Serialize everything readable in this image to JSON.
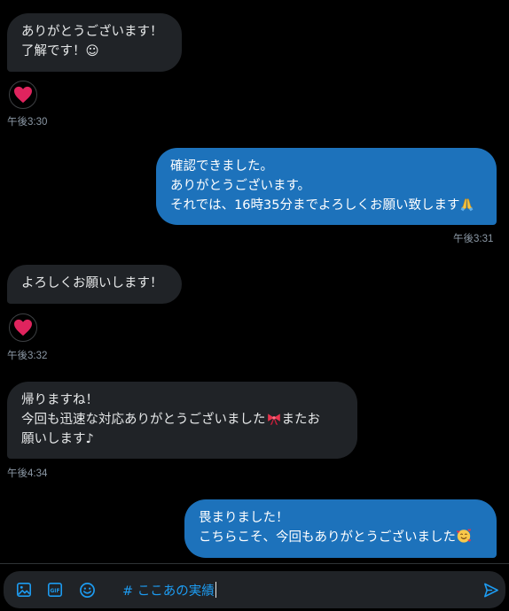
{
  "messages": [
    {
      "direction": "received",
      "lines": [
        "ありがとうございます！",
        "了解です！☺"
      ],
      "reaction": "heart-icon",
      "time": "午後3:30"
    },
    {
      "direction": "sent",
      "lines": [
        "確認できました。",
        "ありがとうございます。",
        "それでは、16時35分までよろしくお願い致します"
      ],
      "emoji": "folded-hands-icon",
      "time": "午後3:31"
    },
    {
      "direction": "received",
      "lines": [
        "よろしくお願いします！"
      ],
      "reaction": "heart-icon",
      "time": "午後3:32"
    },
    {
      "direction": "received",
      "lines": [
        "帰りますね！",
        "今回も迅速な対応ありがとうございました",
        "またお",
        "願いします♪"
      ],
      "emoji": "ribbon-icon",
      "time": "午後4:34"
    },
    {
      "direction": "sent",
      "lines": [
        "畏まりました！",
        "こちらこそ、今回もありがとうございました"
      ],
      "emoji": "smiling-face-with-hearts-icon",
      "time": ""
    }
  ],
  "composer": {
    "draft": "# ここあの実績",
    "icons": [
      "image-icon",
      "gif-icon",
      "emoji-icon",
      "send-icon"
    ]
  },
  "colors": {
    "background": "#000000",
    "received_bubble": "#202327",
    "sent_bubble": "#1d72bb",
    "accent": "#1d9bf0",
    "heart": "#f91880"
  }
}
